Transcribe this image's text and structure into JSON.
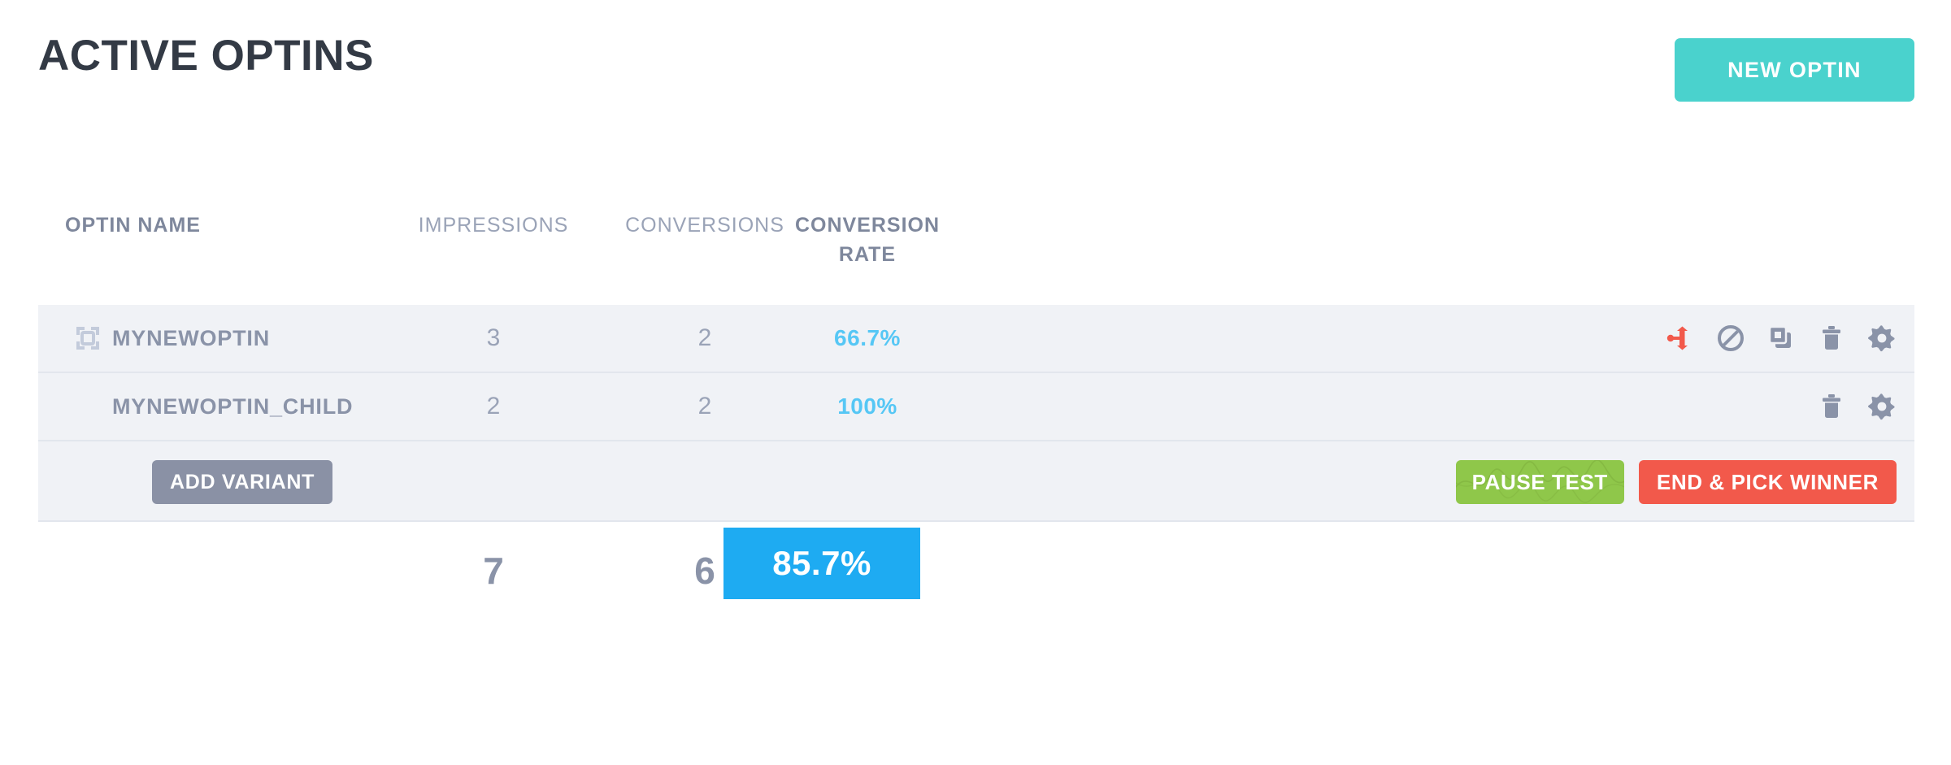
{
  "header": {
    "title": "ACTIVE OPTINS",
    "new_optin_label": "NEW OPTIN"
  },
  "table": {
    "columns": {
      "name": "OPTIN NAME",
      "impressions": "IMPRESSIONS",
      "conversions": "CONVERSIONS",
      "rate_line1": "CONVERSION",
      "rate_line2": "RATE"
    },
    "rows": [
      {
        "name": "MYNEWOPTIN",
        "impressions": "3",
        "conversions": "2",
        "rate": "66.7%",
        "has_drag_handle": true,
        "actions": [
          "split-test-icon",
          "disable-icon",
          "duplicate-icon",
          "trash-icon",
          "gear-icon"
        ]
      },
      {
        "name": "MYNEWOPTIN_CHILD",
        "impressions": "2",
        "conversions": "2",
        "rate": "100%",
        "has_drag_handle": false,
        "actions": [
          "trash-icon",
          "gear-icon"
        ]
      }
    ],
    "controls": {
      "add_variant_label": "ADD VARIANT",
      "pause_test_label": "PAUSE TEST",
      "end_pick_winner_label": "END & PICK WINNER"
    },
    "totals": {
      "impressions": "7",
      "conversions": "6",
      "rate": "85.7%"
    }
  },
  "colors": {
    "accent_teal": "#4ad2cd",
    "rate_blue": "#56c7f5",
    "total_blue": "#1eabf2",
    "green": "#8fc74a",
    "red": "#f2594b",
    "gray_button": "#8a91a5",
    "row_bg": "#f0f2f6",
    "title": "#333a45"
  }
}
